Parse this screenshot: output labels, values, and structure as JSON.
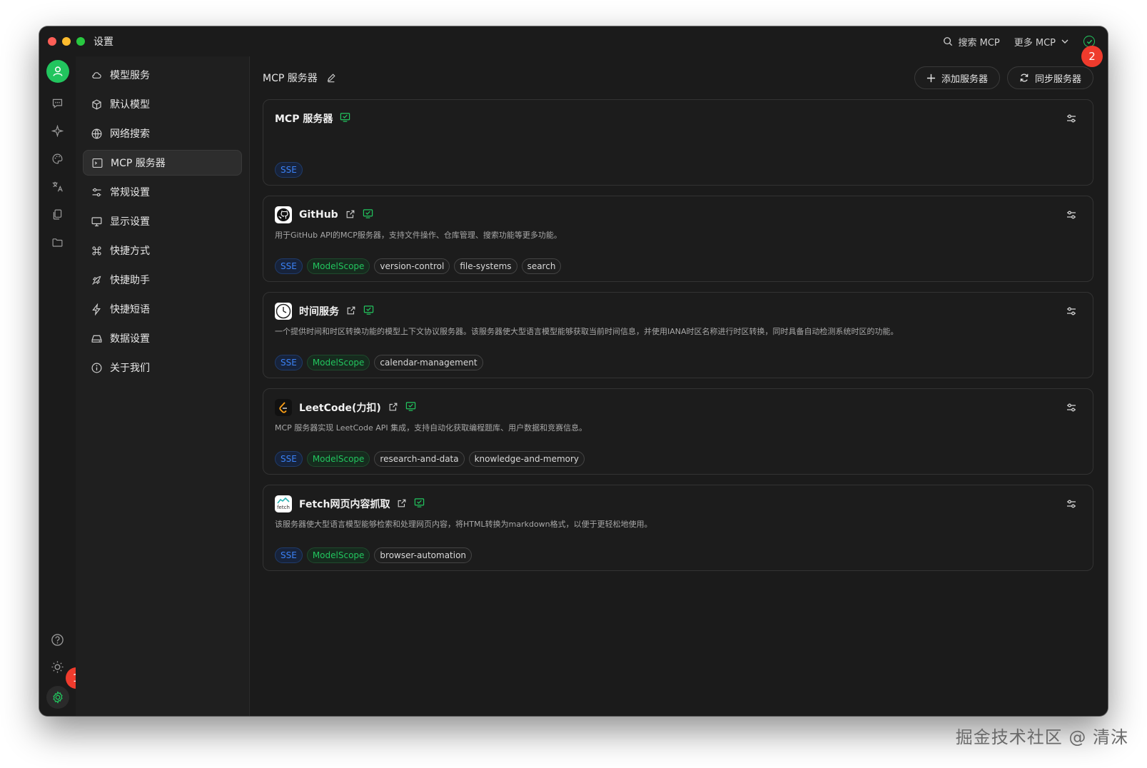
{
  "window": {
    "title": "设置"
  },
  "titlebar": {
    "search": "搜索 MCP",
    "more": "更多 MCP"
  },
  "badges": {
    "one": "1",
    "two": "2"
  },
  "nav": {
    "items": [
      {
        "label": "模型服务",
        "icon": "cloud-icon"
      },
      {
        "label": "默认模型",
        "icon": "cube-icon"
      },
      {
        "label": "网络搜索",
        "icon": "globe-icon"
      },
      {
        "label": "MCP 服务器",
        "icon": "terminal-icon",
        "active": true
      },
      {
        "label": "常规设置",
        "icon": "sliders-icon"
      },
      {
        "label": "显示设置",
        "icon": "monitor-icon"
      },
      {
        "label": "快捷方式",
        "icon": "command-icon"
      },
      {
        "label": "快捷助手",
        "icon": "rocket-icon"
      },
      {
        "label": "快捷短语",
        "icon": "bolt-icon"
      },
      {
        "label": "数据设置",
        "icon": "drive-icon"
      },
      {
        "label": "关于我们",
        "icon": "info-icon"
      }
    ]
  },
  "content": {
    "title": "MCP 服务器",
    "add_button": "添加服务器",
    "sync_button": "同步服务器"
  },
  "servers": [
    {
      "name": "MCP 服务器",
      "desc": "",
      "tags": [
        "SSE"
      ]
    },
    {
      "name": "GitHub",
      "desc": "用于GitHub API的MCP服务器，支持文件操作、仓库管理、搜索功能等更多功能。",
      "tags": [
        "SSE",
        "ModelScope",
        "version-control",
        "file-systems",
        "search"
      ]
    },
    {
      "name": "时间服务",
      "desc": "一个提供时间和时区转换功能的模型上下文协议服务器。该服务器使大型语言模型能够获取当前时间信息，并使用IANA时区名称进行时区转换，同时具备自动检测系统时区的功能。",
      "tags": [
        "SSE",
        "ModelScope",
        "calendar-management"
      ]
    },
    {
      "name": "LeetCode(力扣)",
      "desc": "MCP 服务器实现 LeetCode API 集成，支持自动化获取编程题库、用户数据和竞赛信息。",
      "tags": [
        "SSE",
        "ModelScope",
        "research-and-data",
        "knowledge-and-memory"
      ]
    },
    {
      "name": "Fetch网页内容抓取",
      "desc": "该服务器使大型语言模型能够检索和处理网页内容，将HTML转换为markdown格式，以便于更轻松地使用。",
      "tags": [
        "SSE",
        "ModelScope",
        "browser-automation"
      ]
    }
  ],
  "logos": {
    "fetch_text": "fetch"
  },
  "watermark": "掘金技术社区 @ 清沫",
  "colors": {
    "accent": "#22c55e",
    "badge": "#ef3b2d",
    "sse": "#3b82f6"
  }
}
